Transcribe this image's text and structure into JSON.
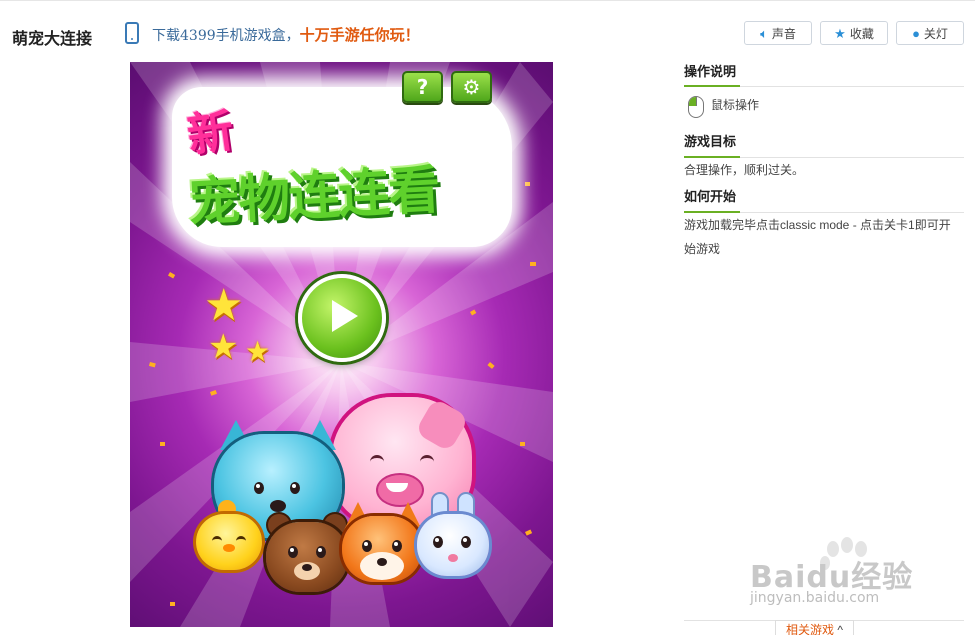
{
  "header": {
    "game_title": "萌宠大连接",
    "promo_prefix": "下载4399手机游戏盒，",
    "promo_highlight": "十万手游任你玩！",
    "buttons": {
      "sound": "声音",
      "favorite": "收藏",
      "lights": "关灯"
    }
  },
  "game": {
    "logo_top": "新",
    "logo_main": "宠物连连看",
    "help_label": "?",
    "settings_icon": "gear-icon",
    "play_icon": "play-icon"
  },
  "sidebar": {
    "controls_title": "操作说明",
    "controls_text": "鼠标操作",
    "goal_title": "游戏目标",
    "goal_text": "合理操作，顺利过关。",
    "start_title": "如何开始",
    "start_text": "游戏加载完毕点击classic mode - 点击关卡1即可开始游戏",
    "related_label": "相关游戏"
  },
  "watermark": {
    "brand": "Baidu经验",
    "url": "jingyan.baidu.com"
  },
  "colors": {
    "accent_green": "#6ab023",
    "promo_blue": "#3a6a9a",
    "promo_orange": "#e05a10",
    "button_icon_blue": "#2b8fd6"
  }
}
